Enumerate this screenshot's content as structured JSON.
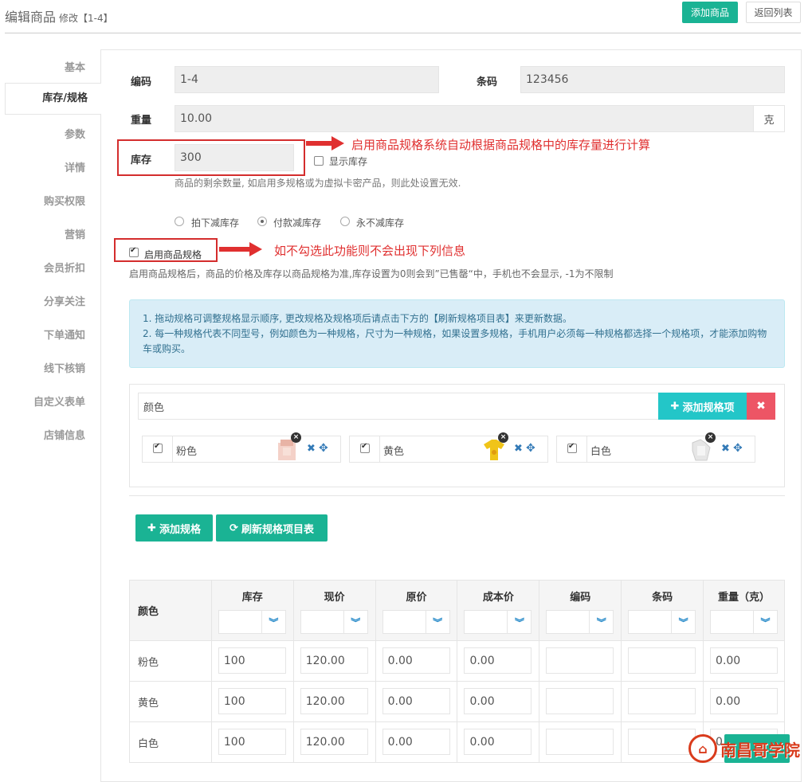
{
  "header": {
    "title": "编辑商品",
    "subtitle": "修改【1-4】",
    "add_goods": "添加商品",
    "back_list": "返回列表"
  },
  "nav": [
    "基本",
    "库存/规格",
    "参数",
    "详情",
    "购买权限",
    "营销",
    "会员折扣",
    "分享关注",
    "下单通知",
    "线下核销",
    "自定义表单",
    "店铺信息"
  ],
  "form": {
    "code_label": "编码",
    "code_value": "1-4",
    "barcode_label": "条码",
    "barcode_value": "123456",
    "weight_label": "重量",
    "weight_value": "10.00",
    "weight_unit": "克",
    "stock_label": "库存",
    "stock_value": "300",
    "show_stock": "显示库存",
    "stock_hint": "商品的剩余数量, 如启用多规格或为虚拟卡密产品，则此处设置无效.",
    "reduce_options": [
      "拍下减库存",
      "付款减库存",
      "永不减库存"
    ],
    "enable_spec": "启用商品规格",
    "spec_hint": "启用商品规格后，商品的价格及库存以商品规格为准,库存设置为0则会到”已售罄“中，手机也不会显示, -1为不限制"
  },
  "annotations": {
    "stock_note": "启用商品规格系统自动根据商品规格中的库存量进行计算",
    "spec_note": "如不勾选此功能则不会出现下列信息"
  },
  "alert": {
    "line1": "1. 拖动规格可调整规格显示顺序, 更改规格及规格项后请点击下方的【刷新规格项目表】来更新数据。",
    "line2": "2. 每一种规格代表不同型号，例如颜色为一种规格，尺寸为一种规格，如果设置多规格，手机用户必须每一种规格都选择一个规格项，才能添加购物车或购买。"
  },
  "spec": {
    "name": "颜色",
    "add_item": "添加规格项",
    "items": [
      "粉色",
      "黄色",
      "白色"
    ]
  },
  "buttons": {
    "add_spec": "添加规格",
    "refresh": "刷新规格项目表"
  },
  "table": {
    "headers": [
      "颜色",
      "库存",
      "现价",
      "原价",
      "成本价",
      "编码",
      "条码",
      "重量（克）"
    ],
    "rows": [
      {
        "name": "粉色",
        "cells": [
          "100",
          "120.00",
          "0.00",
          "0.00",
          "",
          "",
          "0.00"
        ]
      },
      {
        "name": "黄色",
        "cells": [
          "100",
          "120.00",
          "0.00",
          "0.00",
          "",
          "",
          "0.00"
        ]
      },
      {
        "name": "白色",
        "cells": [
          "100",
          "120.00",
          "0.00",
          "0.00",
          "",
          "",
          "0."
        ]
      }
    ]
  },
  "watermark": "南昌哥学院"
}
